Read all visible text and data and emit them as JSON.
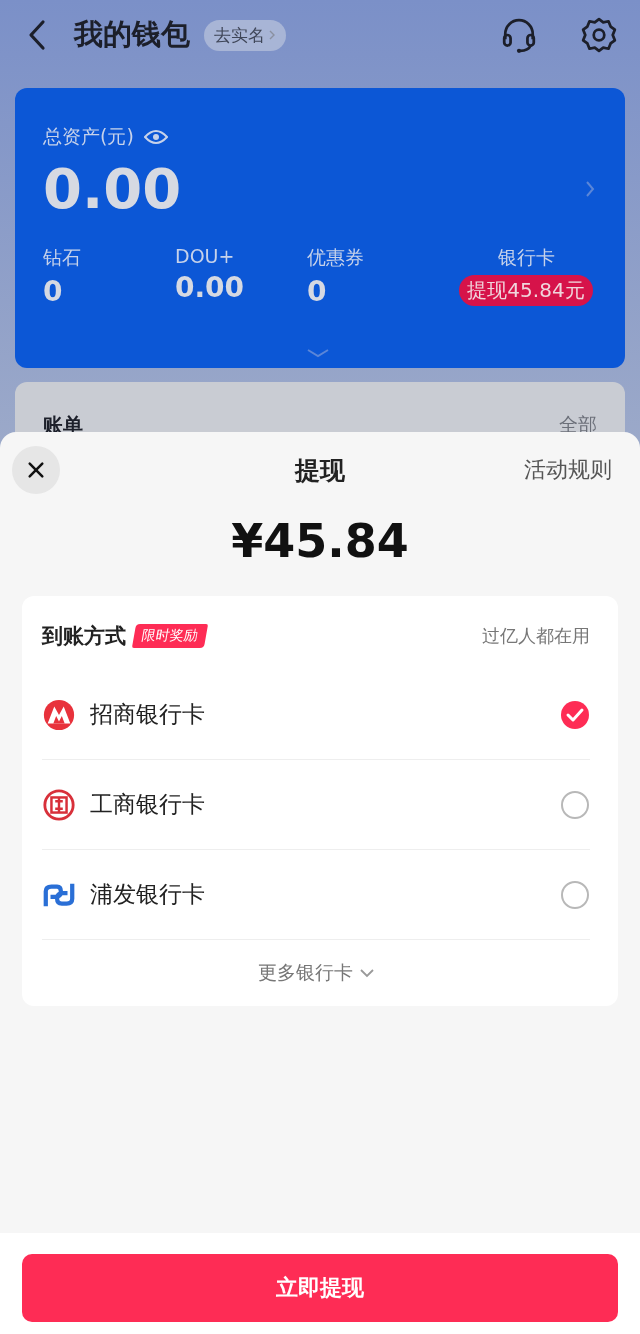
{
  "header": {
    "title": "我的钱包",
    "verify_link": "去实名"
  },
  "assets": {
    "label": "总资产(元)",
    "total": "0.00",
    "items": [
      {
        "label": "钻石",
        "value": "0"
      },
      {
        "label": "DOU+",
        "value": "0.00"
      },
      {
        "label": "优惠券",
        "value": "0"
      },
      {
        "label": "银行卡",
        "badge": "提现45.84元"
      }
    ]
  },
  "bills": {
    "title": "账单",
    "link": "全部"
  },
  "sheet": {
    "title": "提现",
    "rules_link": "活动规则",
    "amount": "¥45.84",
    "method": {
      "title": "到账方式",
      "tag": "限时奖励",
      "note": "过亿人都在用",
      "banks": [
        {
          "name": "招商银行卡",
          "selected": true
        },
        {
          "name": "工商银行卡",
          "selected": false
        },
        {
          "name": "浦发银行卡",
          "selected": false
        }
      ],
      "more": "更多银行卡"
    },
    "submit": "立即提现"
  }
}
